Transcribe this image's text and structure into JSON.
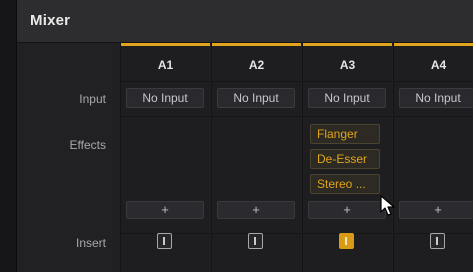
{
  "panel": {
    "title": "Mixer"
  },
  "row_labels": {
    "input": "Input",
    "effects": "Effects",
    "insert": "Insert"
  },
  "colors": {
    "accent": "#e0a41d",
    "background": "#1e1e21",
    "header": "#2d2d30"
  },
  "channels": [
    {
      "name": "A1",
      "input": "No Input",
      "effects": [],
      "add_label": "+",
      "insert_active": false,
      "insert_label": "I"
    },
    {
      "name": "A2",
      "input": "No Input",
      "effects": [],
      "add_label": "+",
      "insert_active": false,
      "insert_label": "I"
    },
    {
      "name": "A3",
      "input": "No Input",
      "effects": [
        "Flanger",
        "De-Esser",
        "Stereo ..."
      ],
      "add_label": "+",
      "insert_active": true,
      "insert_label": "I"
    },
    {
      "name": "A4",
      "input": "No Input",
      "effects": [],
      "add_label": "+",
      "insert_active": false,
      "insert_label": "I"
    }
  ],
  "icons": {
    "cursor": "arrow-cursor-icon",
    "insert": "insert-toggle-icon",
    "add": "plus-icon"
  }
}
